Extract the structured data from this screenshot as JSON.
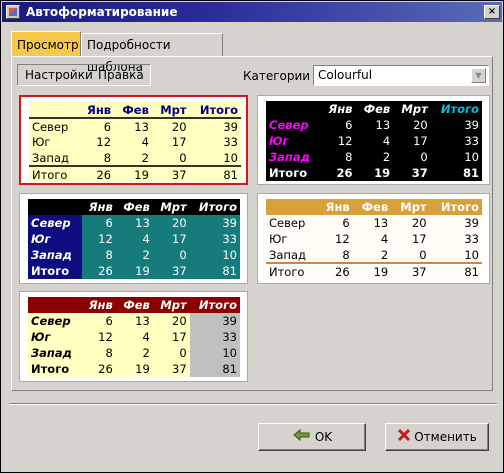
{
  "window": {
    "title": "Автоформатирование"
  },
  "tabs": [
    {
      "label": "Просмотр",
      "active": true
    },
    {
      "label": "Подробности шаблона",
      "active": false
    }
  ],
  "menu": {
    "settings": "Настройки",
    "edit": "Правка"
  },
  "category": {
    "label": "Категории",
    "value": "Colourful"
  },
  "table_data": {
    "header": [
      "",
      "Янв",
      "Фев",
      "Мрт",
      "Итого"
    ],
    "rows": [
      [
        "Север",
        "6",
        "13",
        "20",
        "39"
      ],
      [
        "Юг",
        "12",
        "4",
        "17",
        "33"
      ],
      [
        "Запад",
        "8",
        "2",
        "0",
        "10"
      ],
      [
        "Итого",
        "26",
        "19",
        "37",
        "81"
      ]
    ]
  },
  "colors": {
    "selection_border": "#d01818",
    "tab_active": "#f7c948",
    "yellow_fill": "#ffffc0",
    "teal": "#157b7b",
    "navy": "#0d0d80",
    "orange": "#d8a03a",
    "maroon": "#8b0000",
    "magenta": "#ff00ff",
    "cyan": "#00c0e0"
  },
  "buttons": {
    "ok": "OK",
    "cancel": "Отменить"
  }
}
